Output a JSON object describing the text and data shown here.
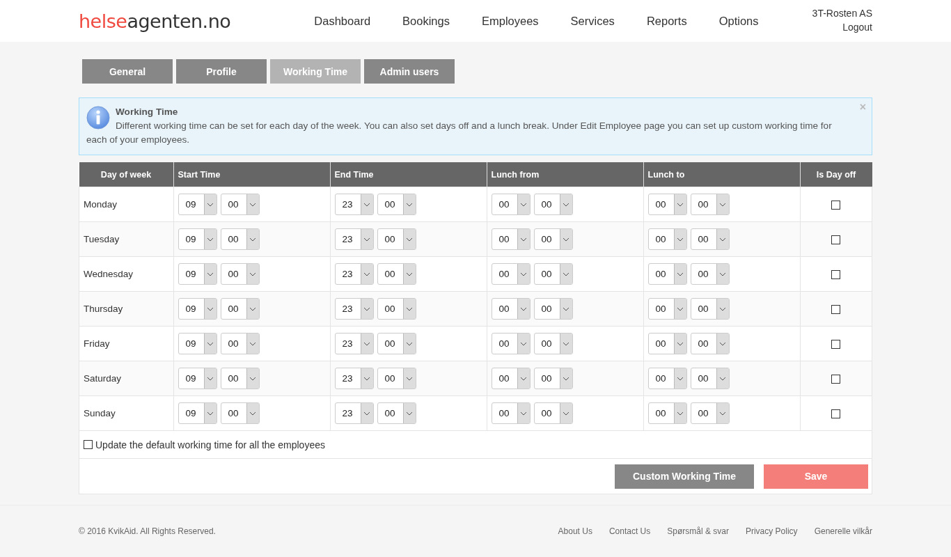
{
  "header": {
    "logo": {
      "accent": "helse",
      "rest": "agenten.no"
    },
    "nav": [
      {
        "label": "Dashboard"
      },
      {
        "label": "Bookings"
      },
      {
        "label": "Employees"
      },
      {
        "label": "Services"
      },
      {
        "label": "Reports"
      },
      {
        "label": "Options"
      }
    ],
    "company": "3T-Rosten AS",
    "logout": "Logout"
  },
  "tabs": [
    {
      "label": "General",
      "selected": false
    },
    {
      "label": "Profile",
      "selected": false
    },
    {
      "label": "Working Time",
      "selected": true
    },
    {
      "label": "Admin users",
      "selected": false
    }
  ],
  "alert": {
    "title": "Working Time",
    "text": "Different working time can be set for each day of the week. You can also set days off and a lunch break. Under Edit Employee page you can set up custom working time for each of your employees.",
    "close": "×"
  },
  "table": {
    "columns": [
      "Day of week",
      "Start Time",
      "End Time",
      "Lunch from",
      "Lunch to",
      "Is Day off"
    ],
    "rows": [
      {
        "day": "Monday",
        "start": [
          "09",
          "00"
        ],
        "end": [
          "23",
          "00"
        ],
        "lunch_from": [
          "00",
          "00"
        ],
        "lunch_to": [
          "00",
          "00"
        ],
        "day_off": false
      },
      {
        "day": "Tuesday",
        "start": [
          "09",
          "00"
        ],
        "end": [
          "23",
          "00"
        ],
        "lunch_from": [
          "00",
          "00"
        ],
        "lunch_to": [
          "00",
          "00"
        ],
        "day_off": false
      },
      {
        "day": "Wednesday",
        "start": [
          "09",
          "00"
        ],
        "end": [
          "23",
          "00"
        ],
        "lunch_from": [
          "00",
          "00"
        ],
        "lunch_to": [
          "00",
          "00"
        ],
        "day_off": false
      },
      {
        "day": "Thursday",
        "start": [
          "09",
          "00"
        ],
        "end": [
          "23",
          "00"
        ],
        "lunch_from": [
          "00",
          "00"
        ],
        "lunch_to": [
          "00",
          "00"
        ],
        "day_off": false
      },
      {
        "day": "Friday",
        "start": [
          "09",
          "00"
        ],
        "end": [
          "23",
          "00"
        ],
        "lunch_from": [
          "00",
          "00"
        ],
        "lunch_to": [
          "00",
          "00"
        ],
        "day_off": false
      },
      {
        "day": "Saturday",
        "start": [
          "09",
          "00"
        ],
        "end": [
          "23",
          "00"
        ],
        "lunch_from": [
          "00",
          "00"
        ],
        "lunch_to": [
          "00",
          "00"
        ],
        "day_off": false
      },
      {
        "day": "Sunday",
        "start": [
          "09",
          "00"
        ],
        "end": [
          "23",
          "00"
        ],
        "lunch_from": [
          "00",
          "00"
        ],
        "lunch_to": [
          "00",
          "00"
        ],
        "day_off": false
      }
    ]
  },
  "update_all": {
    "label": "Update the default working time for all the employees",
    "checked": false
  },
  "buttons": [
    {
      "label": "Custom Working Time",
      "kind": "secondary"
    },
    {
      "label": "Save",
      "kind": "primary"
    }
  ],
  "footer": {
    "copyright": "© 2016 KvikAid. All Rights Reserved.",
    "links": [
      "About Us",
      "Contact Us",
      "Spørsmål & svar",
      "Privacy Policy",
      "Generelle vilkår"
    ]
  }
}
